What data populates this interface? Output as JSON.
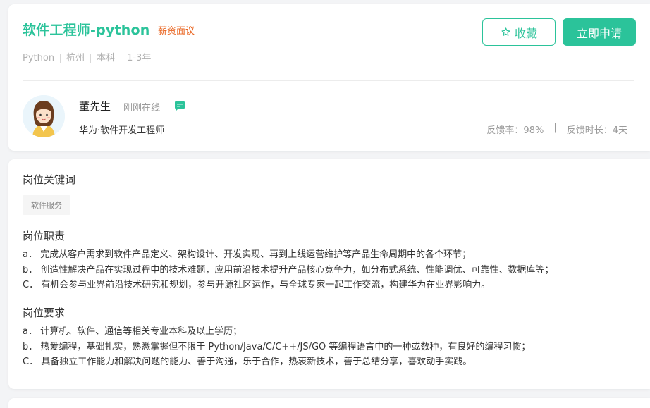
{
  "job": {
    "title": "软件工程师-python",
    "salary": "薪资面议",
    "tags": [
      "Python",
      "杭州",
      "本科",
      "1-3年"
    ],
    "favorite_label": "收藏",
    "apply_label": "立即申请"
  },
  "recruiter": {
    "name": "董先生",
    "status": "刚刚在线",
    "company_title": "华为·软件开发工程师",
    "feedback_rate": "反馈率：98%",
    "separator": "|",
    "feedback_time": "反馈时长：4天"
  },
  "detail": {
    "keywords_title": "岗位关键词",
    "keywords": [
      "软件服务"
    ],
    "duties_title": "岗位职责",
    "duties": [
      "a． 完成从客户需求到软件产品定义、架构设计、开发实现、再到上线运营维护等产品生命周期中的各个环节；",
      "b． 创造性解决产品在实现过程中的技术难题，应用前沿技术提升产品核心竞争力，如分布式系统、性能调优、可靠性、数据库等；",
      "C． 有机会参与业界前沿技术研究和规划，参与开源社区运作，与全球专家一起工作交流，构建华为在业界影响力。"
    ],
    "requirements_title": "岗位要求",
    "requirements": [
      "a． 计算机、软件、通信等相关专业本科及以上学历；",
      "b． 热爱编程，基础扎实，熟悉掌握但不限于 Python/Java/C/C++/JS/GO 等编程语言中的一种或数种，有良好的编程习惯；",
      "C． 具备独立工作能力和解决问题的能力、善于沟通，乐于合作，热衷新技术，善于总结分享，喜欢动手实践。"
    ]
  },
  "colors": {
    "accent": "#2bc39a",
    "salary": "#e9631e",
    "background": "#f3f4f6"
  }
}
